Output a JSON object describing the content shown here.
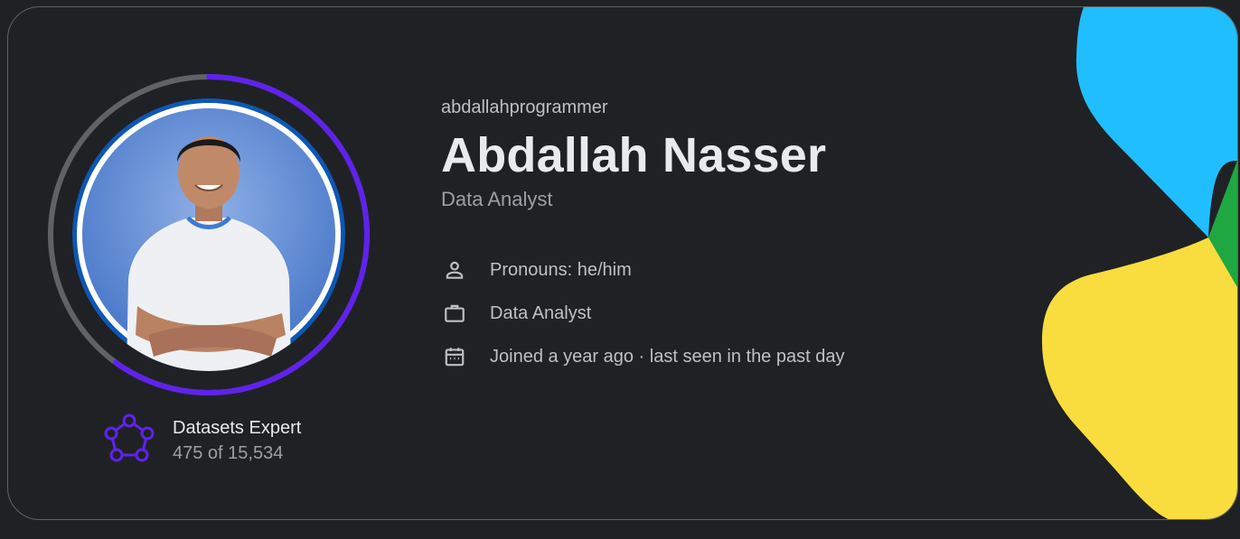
{
  "profile": {
    "username": "abdallahprogrammer",
    "display_name": "Abdallah Nasser",
    "headline": "Data Analyst",
    "progress_fraction": 0.6
  },
  "details": {
    "pronouns": "Pronouns: he/him",
    "occupation": "Data Analyst",
    "joined": "Joined a year ago · last seen in the past day"
  },
  "tier": {
    "title": "Datasets Expert",
    "rank": "475 of 15,534",
    "icon": "datasets-expert-icon"
  },
  "icons": {
    "pronouns": "person-icon",
    "occupation": "briefcase-icon",
    "joined": "calendar-icon"
  },
  "colors": {
    "background": "#202124",
    "ring_progress": "#5f22ee",
    "ring_track": "#5f6368",
    "blob_blue": "#20beff",
    "blob_green": "#1fa842",
    "blob_yellow": "#f9dd3f"
  }
}
